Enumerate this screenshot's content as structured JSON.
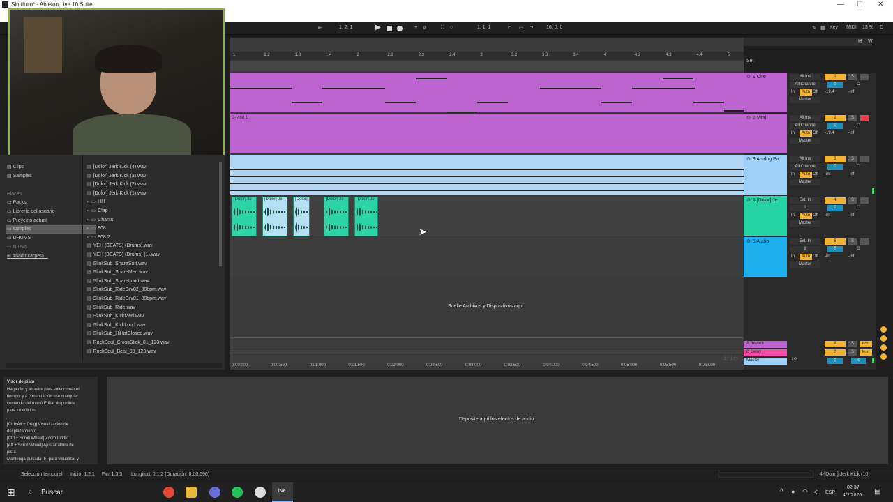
{
  "window": {
    "title": "Sin título* - Ableton Live 10 Suite"
  },
  "transport": {
    "arrangement_position": "1.  2.  1",
    "loop_start": "1.  1.  1",
    "loop_length": "16.  0.  0",
    "key_label": "Key",
    "midi_label": "MIDI",
    "cpu": "13 %",
    "d_label": "D"
  },
  "timeline": {
    "bars": [
      "1",
      "1.2",
      "1.3",
      "1.4",
      "2",
      "2.2",
      "2.3",
      "2.4",
      "3",
      "3.2",
      "3.3",
      "3.4",
      "4",
      "4.2",
      "4.3",
      "4.4",
      "5"
    ],
    "set_label": "Set",
    "times": [
      "0:00:000",
      "0:00:500",
      "0:01:000",
      "0:01:500",
      "0:02:000",
      "0:02:500",
      "0:03:000",
      "0:03:500",
      "0:04:000",
      "0:04:500",
      "0:05:000",
      "0:05:500",
      "0:06:000"
    ],
    "grid": "1/16"
  },
  "browser": {
    "categories": [
      "Clips",
      "Samples"
    ],
    "places_heading": "Places",
    "places": [
      "Packs",
      "Librería del usuario",
      "Proyecto actual",
      "samples",
      "DRUMS",
      "Nuevo",
      "Añadir carpeta..."
    ],
    "files": [
      {
        "name": "[Dolor] Jerk Kick (4).wav",
        "type": "file"
      },
      {
        "name": "[Dolor] Jerk Kick (3).wav",
        "type": "file"
      },
      {
        "name": "[Dolor] Jerk Kick (2).wav",
        "type": "file"
      },
      {
        "name": "[Dolor] Jerk Kick (1).wav",
        "type": "file"
      },
      {
        "name": "HH",
        "type": "folder"
      },
      {
        "name": "Clap",
        "type": "folder"
      },
      {
        "name": "Chants",
        "type": "folder"
      },
      {
        "name": "808",
        "type": "folder"
      },
      {
        "name": "808 2",
        "type": "folder"
      },
      {
        "name": "YEH (BEATS) (Drums).wav",
        "type": "file"
      },
      {
        "name": "YEH (BEATS) (Drums) (1).wav",
        "type": "file"
      },
      {
        "name": "SlinkSub_SnareSoft.wav",
        "type": "file"
      },
      {
        "name": "SlinkSub_SnareMed.wav",
        "type": "file"
      },
      {
        "name": "SlinkSub_SnareLoud.wav",
        "type": "file"
      },
      {
        "name": "SlinkSub_RideGrv02_80bpm.wav",
        "type": "file"
      },
      {
        "name": "SlinkSub_RideGrv01_80bpm.wav",
        "type": "file"
      },
      {
        "name": "SlinkSub_Ride.wav",
        "type": "file"
      },
      {
        "name": "SlinkSub_KickMed.wav",
        "type": "file"
      },
      {
        "name": "SlinkSub_KickLoud.wav",
        "type": "file"
      },
      {
        "name": "SlinkSub_HiHatClosed.wav",
        "type": "file"
      },
      {
        "name": "RockSoul_CrossStick_01_123.wav",
        "type": "file"
      },
      {
        "name": "RockSoul_Beat_03_123.wav",
        "type": "file"
      }
    ]
  },
  "tracks": [
    {
      "name": "1 One",
      "color": "#bd64d1",
      "input": "All Ins",
      "channel": "All Channe",
      "number": "1",
      "volume": "0",
      "pan": "C",
      "send": "-19.4",
      "meter": "-inf",
      "output": "Master",
      "in": "In",
      "auto": "Auto",
      "off": "Off"
    },
    {
      "name": "2 Vital",
      "color": "#bd64d1",
      "input": "All Ins",
      "channel": "All Channe",
      "number": "2",
      "volume": "0",
      "pan": "C",
      "send": "-19.4",
      "meter": "-inf",
      "output": "Master",
      "in": "In",
      "auto": "Auto",
      "off": "Off"
    },
    {
      "name": "3 Analog Pa",
      "color": "#9fd0f8",
      "input": "All Ins",
      "channel": "All Channe",
      "number": "3",
      "volume": "0",
      "pan": "C",
      "send": "-inf",
      "meter": "-inf",
      "output": "Master",
      "in": "In",
      "auto": "Auto",
      "off": "Off"
    },
    {
      "name": "4 [Dolor] Je",
      "color": "#27d4a4",
      "input": "Ext. In",
      "channel": "1",
      "number": "4",
      "volume": "0",
      "pan": "C",
      "send": "-inf",
      "meter": "-inf",
      "output": "Master",
      "in": "In",
      "auto": "Auto",
      "off": "Off"
    },
    {
      "name": "5 Audio",
      "color": "#1fb0ef",
      "input": "Ext. In",
      "channel": "2",
      "number": "5",
      "volume": "0",
      "pan": "C",
      "send": "-inf",
      "meter": "-inf",
      "output": "Master",
      "in": "In",
      "auto": "Auto",
      "off": "Off"
    }
  ],
  "clips": {
    "vital_clip": "2-Vital 1",
    "audio_clip": "[Dolor] Je"
  },
  "returns": [
    {
      "name": "A Reverb",
      "letter": "A",
      "post": "Post",
      "s": "S"
    },
    {
      "name": "B Delay",
      "letter": "B",
      "post": "Post",
      "s": "S"
    }
  ],
  "master": {
    "name": "Master",
    "ratio": "1/2",
    "volume": "0",
    "pan": "0"
  },
  "drop_files_text": "Suelte Archivos y Dispositivos aquí",
  "drop_effects_text": "Deposite aquí los efectos de audio",
  "info_view": {
    "title": "Visor de pista",
    "lines": [
      "Haga clic y arrastre para seleccionar el",
      "tiempo, y a continuación use cualquier",
      "comando del menú Editar disponible",
      "para su edición.",
      "",
      "[Ctrl+Alt + Drag] Visualización de",
      "desplazamiento",
      "[Ctrl + Scroll Wheel] Zoom In/Out",
      "[Alt + Scroll Wheel] Ajustar altura de",
      "pista",
      "Mantenga pulsada [F] para visualizar y"
    ]
  },
  "status": {
    "selection": "Selección temporal",
    "start": "Inicio: 1.2.1",
    "end": "Fin: 1.3.3",
    "length": "Longitud: 0.1.2 (Duración: 0:00:596)",
    "selected_clip": "4-[Dolor] Jerk Kick (10)"
  },
  "taskbar": {
    "search": "Buscar",
    "lang": "ESP",
    "time": "02:37",
    "date": "4/2/2026"
  },
  "colors": {
    "accent": "#f2b233",
    "midi": "#bd64d1",
    "audio": "#27d4a4"
  }
}
